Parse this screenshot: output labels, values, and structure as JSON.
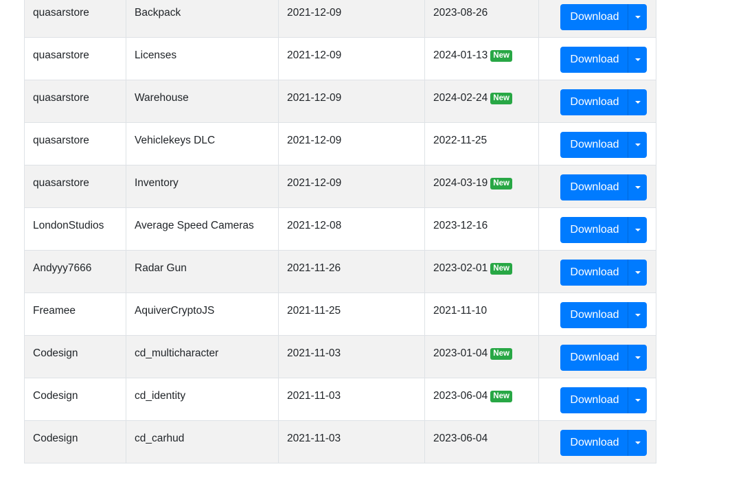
{
  "table": {
    "rows": [
      {
        "author": "quasarstore",
        "name": "Backpack",
        "created": "2021-12-09",
        "updated": "2023-08-26",
        "badge": "",
        "button": "Download"
      },
      {
        "author": "quasarstore",
        "name": "Licenses",
        "created": "2021-12-09",
        "updated": "2024-01-13",
        "badge": "New",
        "button": "Download"
      },
      {
        "author": "quasarstore",
        "name": "Warehouse",
        "created": "2021-12-09",
        "updated": "2024-02-24",
        "badge": "New",
        "button": "Download"
      },
      {
        "author": "quasarstore",
        "name": "Vehiclekeys DLC",
        "created": "2021-12-09",
        "updated": "2022-11-25",
        "badge": "",
        "button": "Download"
      },
      {
        "author": "quasarstore",
        "name": "Inventory",
        "created": "2021-12-09",
        "updated": "2024-03-19",
        "badge": "New",
        "button": "Download"
      },
      {
        "author": "LondonStudios",
        "name": "Average Speed Cameras",
        "created": "2021-12-08",
        "updated": "2023-12-16",
        "badge": "",
        "button": "Download"
      },
      {
        "author": "Andyyy7666",
        "name": "Radar Gun",
        "created": "2021-11-26",
        "updated": "2023-02-01",
        "badge": "New",
        "button": "Download"
      },
      {
        "author": "Freamee",
        "name": "AquiverCryptoJS",
        "created": "2021-11-25",
        "updated": "2021-11-10",
        "badge": "",
        "button": "Download"
      },
      {
        "author": "Codesign",
        "name": "cd_multicharacter",
        "created": "2021-11-03",
        "updated": "2023-01-04",
        "badge": "New",
        "button": "Download"
      },
      {
        "author": "Codesign",
        "name": "cd_identity",
        "created": "2021-11-03",
        "updated": "2023-06-04",
        "badge": "New",
        "button": "Download"
      },
      {
        "author": "Codesign",
        "name": "cd_carhud",
        "created": "2021-11-03",
        "updated": "2023-06-04",
        "badge": "",
        "button": "Download"
      }
    ]
  },
  "icons": {
    "dropdown": "caret-down-icon"
  },
  "colors": {
    "primary": "#007bff",
    "badge_new": "#28a745",
    "row_stripe": "#f2f2f2",
    "border": "#dee2e6"
  }
}
